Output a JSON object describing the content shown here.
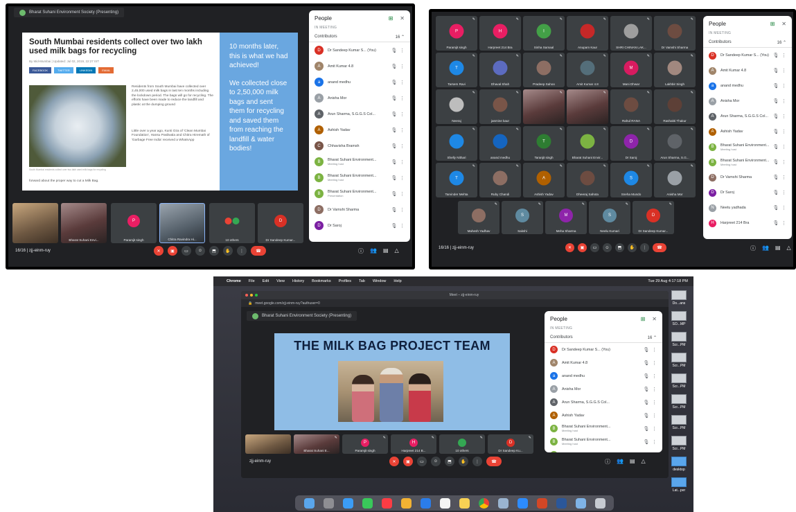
{
  "meeting": {
    "code": "zjj-einm-ruy",
    "count": "16/16",
    "presenter": "Bharat Suhani Environment Society (Presenting)",
    "url": "meet.google.com/zjj-einm-ruy?authuser=0",
    "window_title": "Meet – zjj-einm-ruy"
  },
  "people_panel": {
    "title": "People",
    "subtitle": "IN MEETING",
    "group": "Contributors",
    "group_count": "16",
    "rows_a": [
      {
        "name": "Dr Sandeep Kumar S... (You)",
        "color": "#d93025",
        "initial": "D"
      },
      {
        "name": "Amit Kumar 4.8",
        "color": "#a0856a",
        "initial": "A"
      },
      {
        "name": "anand medhu",
        "color": "#1a73e8",
        "initial": "a"
      },
      {
        "name": "Anisha Mor",
        "color": "#9aa0a6",
        "initial": "A"
      },
      {
        "name": "Arun Sharma, S.G.G.S Col...",
        "color": "#5f6368",
        "initial": "A"
      },
      {
        "name": "Ashish Yadav",
        "color": "#b06000",
        "initial": "A"
      },
      {
        "name": "Chhavisha Bramsh",
        "color": "#795548",
        "initial": "C"
      },
      {
        "name": "Bharat Suhani Environment...",
        "sub": "Meeting host",
        "color": "#7cb342",
        "initial": "B"
      },
      {
        "name": "Bharat Suhani Environment...",
        "sub": "Meeting host",
        "color": "#7cb342",
        "initial": "B"
      },
      {
        "name": "Bharat Suhani Environment...",
        "sub": "Presentation",
        "color": "#7cb342",
        "initial": "B"
      },
      {
        "name": "Dr Vamshi Sharma",
        "color": "#8d6e63",
        "initial": "D"
      },
      {
        "name": "Dr Saroj",
        "color": "#7b1fa2",
        "initial": "D"
      }
    ],
    "rows_b": [
      {
        "name": "Dr Sandeep Kumar S... (You)",
        "color": "#d93025",
        "initial": "D"
      },
      {
        "name": "Amit Kumar 4.8",
        "color": "#a0856a",
        "initial": "A"
      },
      {
        "name": "anand medhu",
        "color": "#1a73e8",
        "initial": "a"
      },
      {
        "name": "Anisha Mor",
        "color": "#9aa0a6",
        "initial": "A"
      },
      {
        "name": "Arun Sharma, S.G.G.S Col...",
        "color": "#5f6368",
        "initial": "A"
      },
      {
        "name": "Ashish Yadav",
        "color": "#b06000",
        "initial": "A"
      },
      {
        "name": "Bharat Suhani Environment...",
        "sub": "Meeting host",
        "color": "#7cb342",
        "initial": "B"
      },
      {
        "name": "Bharat Suhani Environment...",
        "sub": "Meeting host",
        "color": "#7cb342",
        "initial": "B"
      },
      {
        "name": "Dr Vamshi Sharma",
        "color": "#8d6e63",
        "initial": "D"
      },
      {
        "name": "Dr Saroj",
        "color": "#7b1fa2",
        "initial": "D"
      },
      {
        "name": "Neetu yadhada",
        "color": "#9aa0a6",
        "initial": "N"
      },
      {
        "name": "Harpreet 214 Bra",
        "color": "#e91e63",
        "initial": "H"
      }
    ],
    "rows_c": [
      {
        "name": "Dr Sandeep Kumar S... (You)",
        "color": "#d93025",
        "initial": "D"
      },
      {
        "name": "Amit Kumar 4.8",
        "color": "#a0856a",
        "initial": "A"
      },
      {
        "name": "anand medhu",
        "color": "#1a73e8",
        "initial": "a"
      },
      {
        "name": "Anisha Mor",
        "color": "#9aa0a6",
        "initial": "A"
      },
      {
        "name": "Arun Sharma, S.G.G.S Col...",
        "color": "#5f6368",
        "initial": "A"
      },
      {
        "name": "Ashish Yadav",
        "color": "#b06000",
        "initial": "A"
      },
      {
        "name": "Bharat Suhani Environment...",
        "sub": "Meeting host",
        "color": "#7cb342",
        "initial": "B"
      },
      {
        "name": "Bharat Suhani Environment...",
        "sub": "Meeting host",
        "color": "#7cb342",
        "initial": "B"
      },
      {
        "name": "Bharat Suhani Environment...",
        "color": "#7cb342",
        "initial": "B"
      }
    ]
  },
  "screen1": {
    "headline": "South Mumbai residents collect over two lakh used milk bags for recycling",
    "byline": "By Mid-Mumbai | Updated: Jul 02, 2019, 22:27 IST",
    "share": [
      "FACEBOOK",
      "TWITTER",
      "LINKEDIN",
      "EMAIL"
    ],
    "para1": "Residents from South Mumbai have collected over 2,45,000 used milk bags in last ten months including the lockdown period. The bags will go for recycling. The efforts have been made to reduce the landfill and plastic at the dumping ground",
    "para2": "Little over a year ago, Kunti Oza of 'Clean Mumbai Foundation', Hansu Pasilwala and Chitra Hiremath of 'Garbage Free India' received a WhatsApp",
    "para3": "forward about the proper way to cut a Milk Bag.",
    "caption": "South Mumbai residents collect over two lakh used milk bags for recycling",
    "side_p1": "10 months later, this is what we had achieved!",
    "side_p2": "We collected close to 2,50,000 milk bags and sent them for recycling and saved them from reaching the landfill & water bodies!",
    "tiles": [
      "",
      "Bharat Suhani Envi...",
      "Paramjit singh",
      "Chitra Ravindra Hi...",
      "10 others",
      "Dr Sandeep Kumar..."
    ]
  },
  "screen2": {
    "grid": [
      {
        "n": "Paramjit singh",
        "i": "P",
        "c": "#e91e63"
      },
      {
        "n": "Harpreet 214 Bra",
        "i": "H",
        "c": "#e91e63"
      },
      {
        "n": "Sinha Samaal",
        "i": "I",
        "c": "#43a047"
      },
      {
        "n": "Anupam Kaur",
        "i": "",
        "c": "#c62828"
      },
      {
        "n": "SHRI CHINAN LAK...",
        "i": "",
        "c": "#9e9e9e"
      },
      {
        "n": "Dr Vamshi Sharma",
        "i": "",
        "c": "#6d4c41"
      },
      {
        "n": "Tarsem Ravi",
        "i": "T",
        "c": "#1e88e5"
      },
      {
        "n": "Dhaval Shah",
        "i": "",
        "c": "#5c6bc0"
      },
      {
        "n": "Pradeep Sahoo",
        "i": "",
        "c": "#8d6e63"
      },
      {
        "n": "Amit Kumar 4.8",
        "i": "",
        "c": "#546e7a"
      },
      {
        "n": "Mani Dhwar",
        "i": "M",
        "c": "#d81b60"
      },
      {
        "n": "Lakhbir Singh",
        "i": "",
        "c": "#a1887f"
      },
      {
        "n": "Neeraj",
        "i": "",
        "c": "#bdbdbd"
      },
      {
        "n": "jasmine kaur",
        "i": "",
        "c": "#795548"
      },
      {
        "n": "",
        "i": "",
        "c": "video"
      },
      {
        "n": "",
        "i": "",
        "c": "video"
      },
      {
        "n": "Rahul RANA",
        "i": "",
        "c": "#6d4c41"
      },
      {
        "n": "Rashakti Thakur",
        "i": "",
        "c": "#5d4037"
      },
      {
        "n": "Shelly Nithari",
        "i": "",
        "c": "#1e88e5"
      },
      {
        "n": "anand medhu",
        "i": "",
        "c": "#1565c0"
      },
      {
        "n": "Taranjit singh",
        "i": "T",
        "c": "#2e7d32"
      },
      {
        "n": "Bharat Suhani Envir...",
        "i": "",
        "c": "#7cb342"
      },
      {
        "n": "Dr Saroj",
        "i": "D",
        "c": "#8e24aa"
      },
      {
        "n": "Arun Sharma, S.G...",
        "i": "",
        "c": "#5f6368"
      },
      {
        "n": "Tarvinder Mehta",
        "i": "T",
        "c": "#1e88e5"
      },
      {
        "n": "Ruby Chandi",
        "i": "",
        "c": "#8d6e63"
      },
      {
        "n": "Ashish Yadav",
        "i": "A",
        "c": "#b06000"
      },
      {
        "n": "Dheeraj Sahota",
        "i": "",
        "c": "#6d4c41"
      },
      {
        "n": "Sneha Mundo",
        "i": "S",
        "c": "#1e88e5"
      },
      {
        "n": "Anisha Mor",
        "i": "",
        "c": "#9aa0a6"
      }
    ],
    "bottom": [
      {
        "n": "Mahesh Yadhav",
        "i": "",
        "c": "#8d6e63"
      },
      {
        "n": "Sakshi",
        "i": "S",
        "c": "#5f8aa0"
      },
      {
        "n": "Meha Sharma",
        "i": "M",
        "c": "#8e24aa"
      },
      {
        "n": "Neelu Kumari",
        "i": "S",
        "c": "#5f8aa0"
      },
      {
        "n": "Dr Sandeep Kumar...",
        "i": "D",
        "c": "#d93025"
      }
    ]
  },
  "screen3": {
    "menu": [
      "Chrome",
      "File",
      "Edit",
      "View",
      "History",
      "Bookmarks",
      "Profiles",
      "Tab",
      "Window",
      "Help"
    ],
    "clock": "Tue 29 Aug 4:17:18 PM",
    "slide_title": "THE MILK BAG PROJECT TEAM",
    "tiles": [
      "",
      "Bharat Suhani E...",
      "Paramjit singh",
      "Harpreet 214 B...",
      "10 others",
      "Dr Sandeep Ku..."
    ],
    "desktop": [
      "Do...ans",
      "SO...MP",
      "Scr...PM",
      "Scr...PM",
      "Scr...PM",
      "Scr...PM",
      "Scr...PM",
      "Scr...PM",
      "desktop",
      "Lat...per"
    ]
  }
}
